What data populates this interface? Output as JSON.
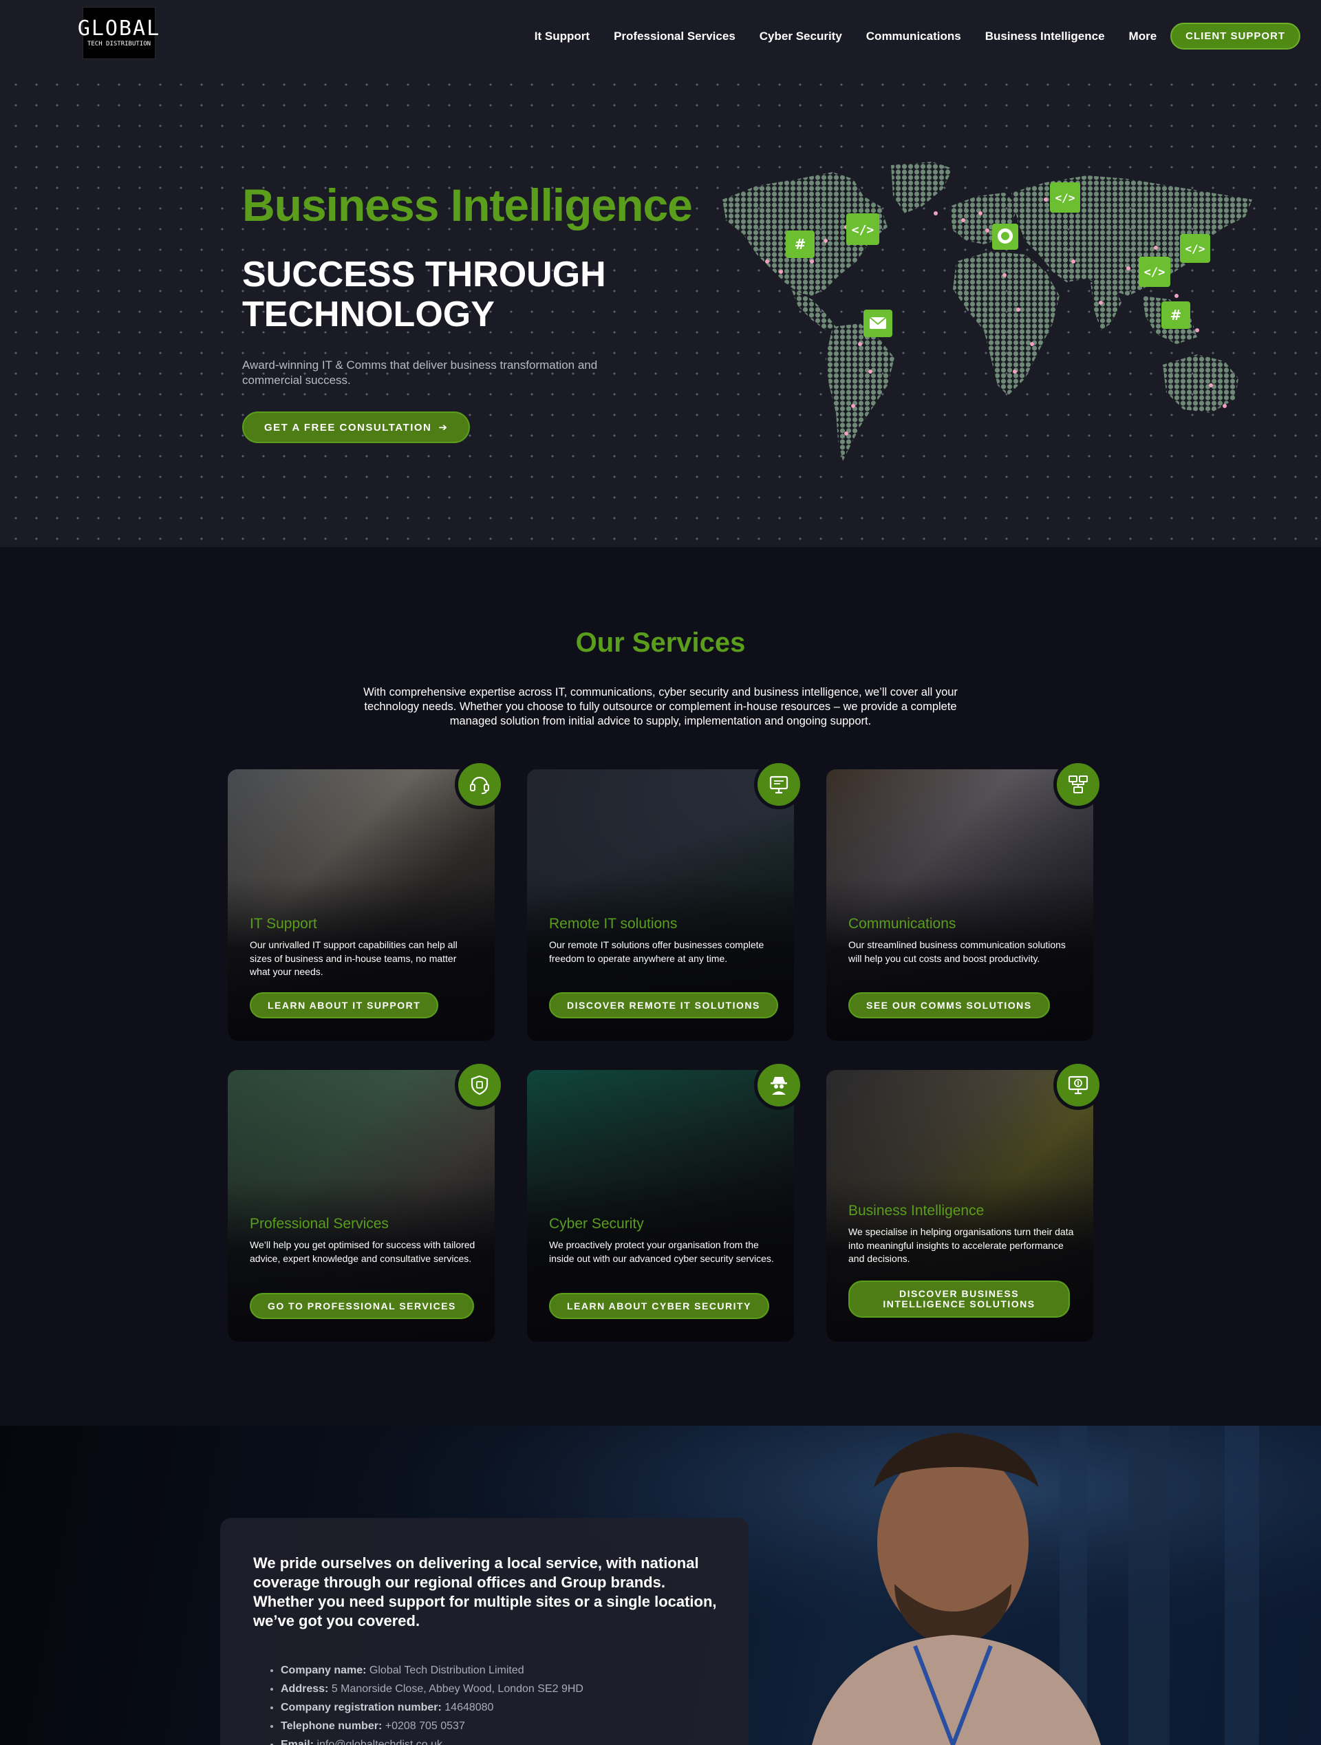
{
  "logo": {
    "line1": "GLOBAL",
    "line2": "TECH DISTRIBUTION"
  },
  "nav": {
    "items": [
      "It Support",
      "Professional Services",
      "Cyber Security",
      "Communications",
      "Business Intelligence",
      "More"
    ],
    "client_support": "CLIENT SUPPORT"
  },
  "hero": {
    "title": "Business Intelligence",
    "subtitle_line1": "SUCCESS THROUGH",
    "subtitle_line2": "TECHNOLOGY",
    "description": "Award-winning IT & Comms that deliver business transformation and commercial success.",
    "cta": "GET A FREE CONSULTATION",
    "cta_arrow": "➔"
  },
  "services": {
    "title": "Our Services",
    "description": "With comprehensive expertise across IT, communications, cyber security and business intelligence, we’ll cover all your technology needs. Whether you choose to fully outsource or complement in-house resources – we provide a complete managed solution from initial advice to supply, implementation and ongoing support.",
    "cards": [
      {
        "title": "IT Support",
        "text": "Our unrivalled IT support capabilities can help all sizes of business and in-house teams, no matter what your needs.",
        "button": "LEARN ABOUT IT SUPPORT",
        "icon": "headset-icon"
      },
      {
        "title": "Remote IT solutions",
        "text": "Our remote IT solutions offer businesses complete freedom to operate anywhere at any time.",
        "button": "DISCOVER REMOTE IT SOLUTIONS",
        "icon": "monitor-icon"
      },
      {
        "title": "Communications",
        "text": "Our streamlined business communication solutions will help you cut costs and boost productivity.",
        "button": "SEE OUR COMMS SOLUTIONS",
        "icon": "network-icon"
      },
      {
        "title": "Professional Services",
        "text": "We’ll help you get optimised for success with tailored advice, expert knowledge and consultative services.",
        "button": "GO TO PROFESSIONAL SERVICES",
        "icon": "shield-icon"
      },
      {
        "title": "Cyber Security",
        "text": "We proactively protect your organisation from the inside out with our advanced cyber security services.",
        "button": "LEARN ABOUT CYBER SECURITY",
        "icon": "spy-icon"
      },
      {
        "title": "Business Intelligence",
        "text": "We specialise in helping organisations turn their data into meaningful insights to accelerate performance and decisions.",
        "button": "DISCOVER BUSINESS INTELLIGENCE SOLUTIONS",
        "icon": "analytics-icon"
      }
    ]
  },
  "coverage": {
    "heading": "We pride ourselves on delivering a local service, with national coverage through our regional offices and Group brands. Whether you need support for multiple sites or a single location, we’ve got you covered.",
    "details": [
      {
        "label": "Company name:",
        "value": "Global Tech Distribution Limited"
      },
      {
        "label": "Address:",
        "value": "5 Manorside Close, Abbey Wood, London SE2 9HD"
      },
      {
        "label": "Company registration number:",
        "value": "14648080"
      },
      {
        "label": "Telephone number:",
        "value": "+0208 705 0537"
      },
      {
        "label": "Email:",
        "value": "info@globaltechdist.co.uk"
      }
    ]
  },
  "colors": {
    "accent": "#5a9e1c",
    "button": "#4e7d15",
    "background": "#0e0f18",
    "hero_bg": "#1a1b24"
  }
}
